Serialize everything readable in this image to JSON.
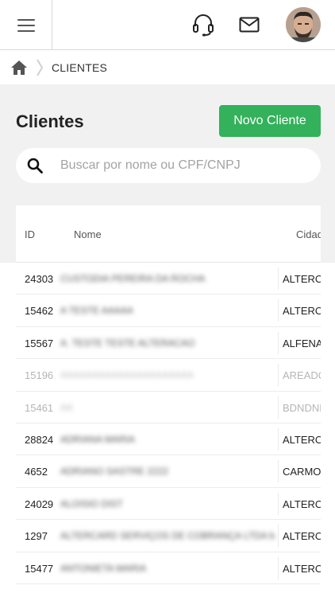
{
  "header": {
    "menu_icon": "hamburger-menu-icon",
    "support_icon": "headset-icon",
    "mail_icon": "mail-icon",
    "avatar_icon": "user-avatar"
  },
  "breadcrumb": {
    "home_icon": "home-icon",
    "current": "CLIENTES"
  },
  "page": {
    "title": "Clientes",
    "new_button_label": "Novo Cliente",
    "accent_color": "#34b15b"
  },
  "search": {
    "placeholder": "Buscar por nome ou CPF/CNPJ",
    "value": ""
  },
  "table": {
    "columns": [
      "ID",
      "Nome",
      "Cidade"
    ],
    "rows": [
      {
        "id": "24303",
        "name": "CUSTODIA PEREIRA DA ROCHA",
        "city": "ALTEROSA",
        "dim": false
      },
      {
        "id": "15462",
        "name": "A TESTE AAAAA",
        "city": "ALTEROSA",
        "dim": false
      },
      {
        "id": "15567",
        "name": "A. TESTE TESTE ALTERACAO",
        "city": "ALFENAS",
        "dim": false
      },
      {
        "id": "15196",
        "name": "AAAAAAAAAAAAAAAAAAAAA",
        "city": "AREADO",
        "dim": true
      },
      {
        "id": "15461",
        "name": "AA",
        "city": "BDNDNDN",
        "dim": true
      },
      {
        "id": "28824",
        "name": "ADRIANA MARIA",
        "city": "ALTEROSA",
        "dim": false
      },
      {
        "id": "4652",
        "name": "ADRIANO SASTRE 2222",
        "city": "CARMO",
        "dim": false
      },
      {
        "id": "24029",
        "name": "ALOISIO DIST",
        "city": "ALTEROSA",
        "dim": false
      },
      {
        "id": "1297",
        "name": "ALTERCARD SERVIÇOS DE COBRANÇA LTDA M",
        "city": "ALTEROSA",
        "dim": false
      },
      {
        "id": "15477",
        "name": "ANTONIETA MARIA",
        "city": "ALTEROSA",
        "dim": false
      }
    ]
  }
}
